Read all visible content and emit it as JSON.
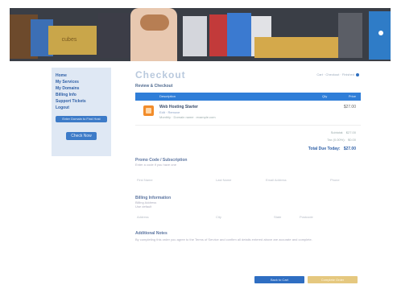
{
  "header": {
    "logo_text": "cubes",
    "colors": {
      "banner_bg": "#3a3e46",
      "accent_blue": "#2f7cc7",
      "accent_gold": "#d4a94b"
    }
  },
  "sidebar": {
    "links": [
      "Home",
      "My Services",
      "My Domains",
      "Billing Info",
      "Support Tickets",
      "Logout"
    ],
    "search_text": "Enter Domain to Find Host",
    "button_label": "Check Now"
  },
  "main": {
    "title": "Checkout",
    "steps": "Cart · Checkout · Finished",
    "section_review": "Review & Checkout",
    "table": {
      "headers": [
        "Description",
        "Qty",
        "Price"
      ],
      "item": {
        "name": "Web Hosting Starter",
        "sub": "Edit · Remove",
        "desc": "Monthly · Domain name : example.com",
        "price": "$27.00"
      }
    },
    "totals": {
      "subtotal_label": "Subtotal:",
      "subtotal_value": "$27.00",
      "tax_label": "Tax (0.00%):",
      "tax_value": "$0.00",
      "total_label": "Total Due Today:",
      "total_value": "$27.00"
    },
    "promo": {
      "title": "Promo Code / Subscription",
      "hint": "Enter a code if you have one"
    },
    "form_row_1": [
      "First Name",
      "Last Name",
      "Email Address",
      "Phone"
    ],
    "billing": {
      "title": "Billing Information",
      "line1": "Billing Address",
      "line2": "Use default"
    },
    "form_row_2": [
      "Address",
      "City",
      "State",
      "Postcode"
    ],
    "payment": {
      "title": "Additional Notes",
      "text": "By completing this order you agree to the Terms of Service and confirm all details entered above are accurate and complete."
    },
    "buttons": {
      "back": "Back to Cart",
      "complete": "Complete Order"
    }
  }
}
